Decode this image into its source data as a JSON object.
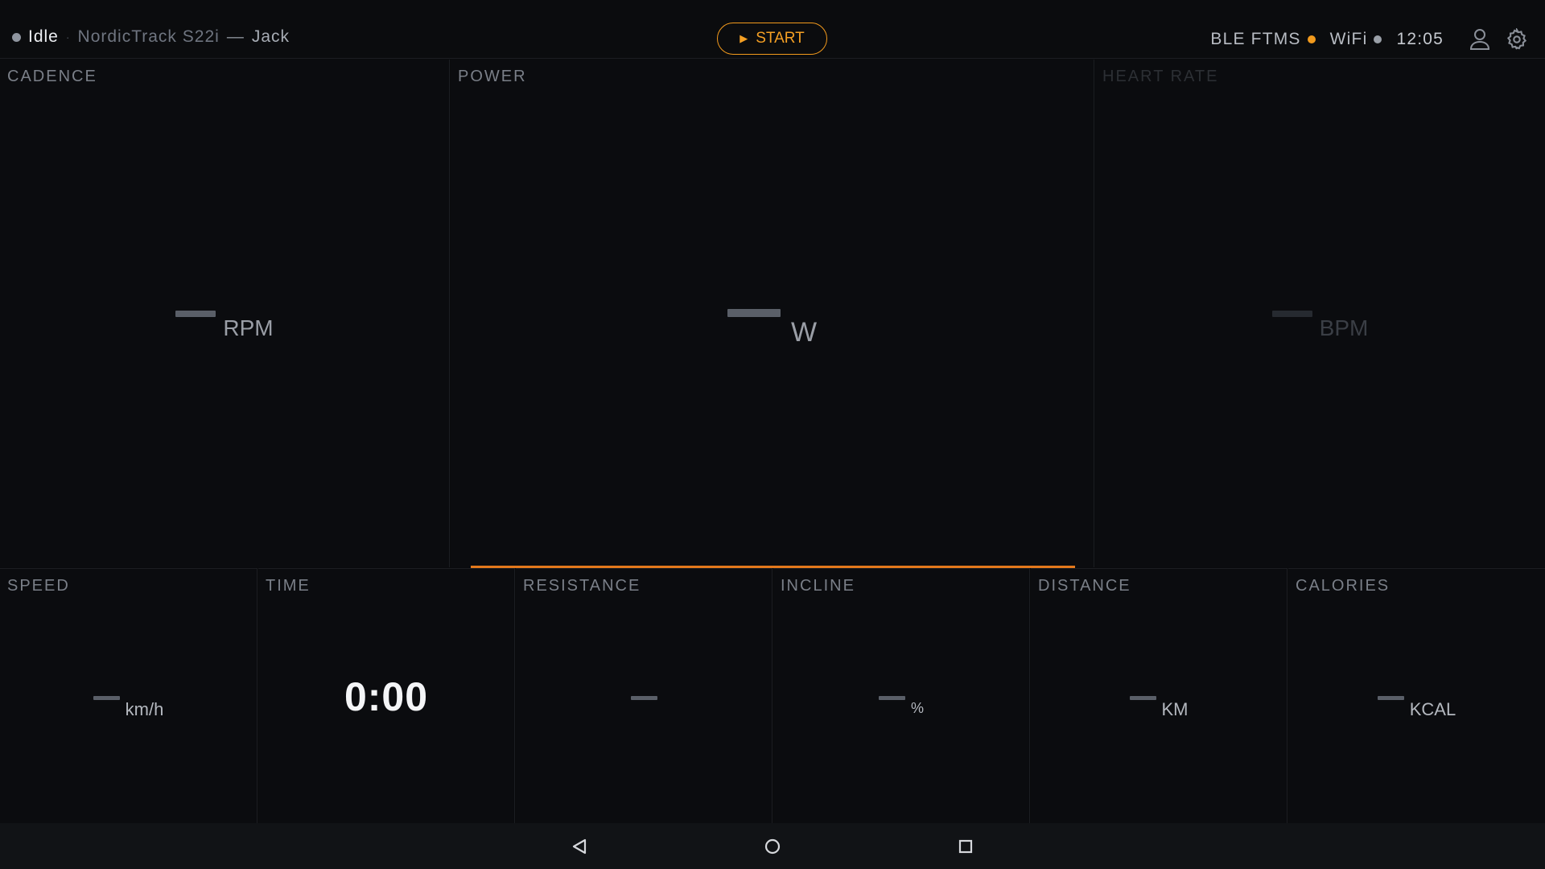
{
  "topbar": {
    "status": "Idle",
    "device": "NordicTrack S22i",
    "dash": "—",
    "user": "Jack",
    "start_label": "START",
    "ble_label": "BLE FTMS",
    "wifi_label": "WiFi",
    "clock": "12:05",
    "ble_status_color": "#f29a1d"
  },
  "panels": {
    "cadence": {
      "label": "CADENCE",
      "unit": "RPM"
    },
    "power": {
      "label": "POWER",
      "unit": "W"
    },
    "heart_rate": {
      "label": "HEART RATE",
      "unit": "BPM"
    }
  },
  "metrics": {
    "speed": {
      "label": "SPEED",
      "unit": "km/h"
    },
    "time": {
      "label": "TIME",
      "value": "0:00"
    },
    "resistance": {
      "label": "RESISTANCE"
    },
    "incline": {
      "label": "INCLINE",
      "unit": "%"
    },
    "distance": {
      "label": "DISTANCE",
      "unit": "KM"
    },
    "calories": {
      "label": "CALORIES",
      "unit": "KCAL"
    }
  },
  "colors": {
    "accent": "#f39a1c",
    "accent_line": "#e3781c",
    "background": "#0a0b0d"
  },
  "icons": {
    "play": "play-icon",
    "profile": "user-icon",
    "settings": "gear-icon",
    "back": "back-icon",
    "home": "home-icon",
    "recents": "recents-icon"
  }
}
